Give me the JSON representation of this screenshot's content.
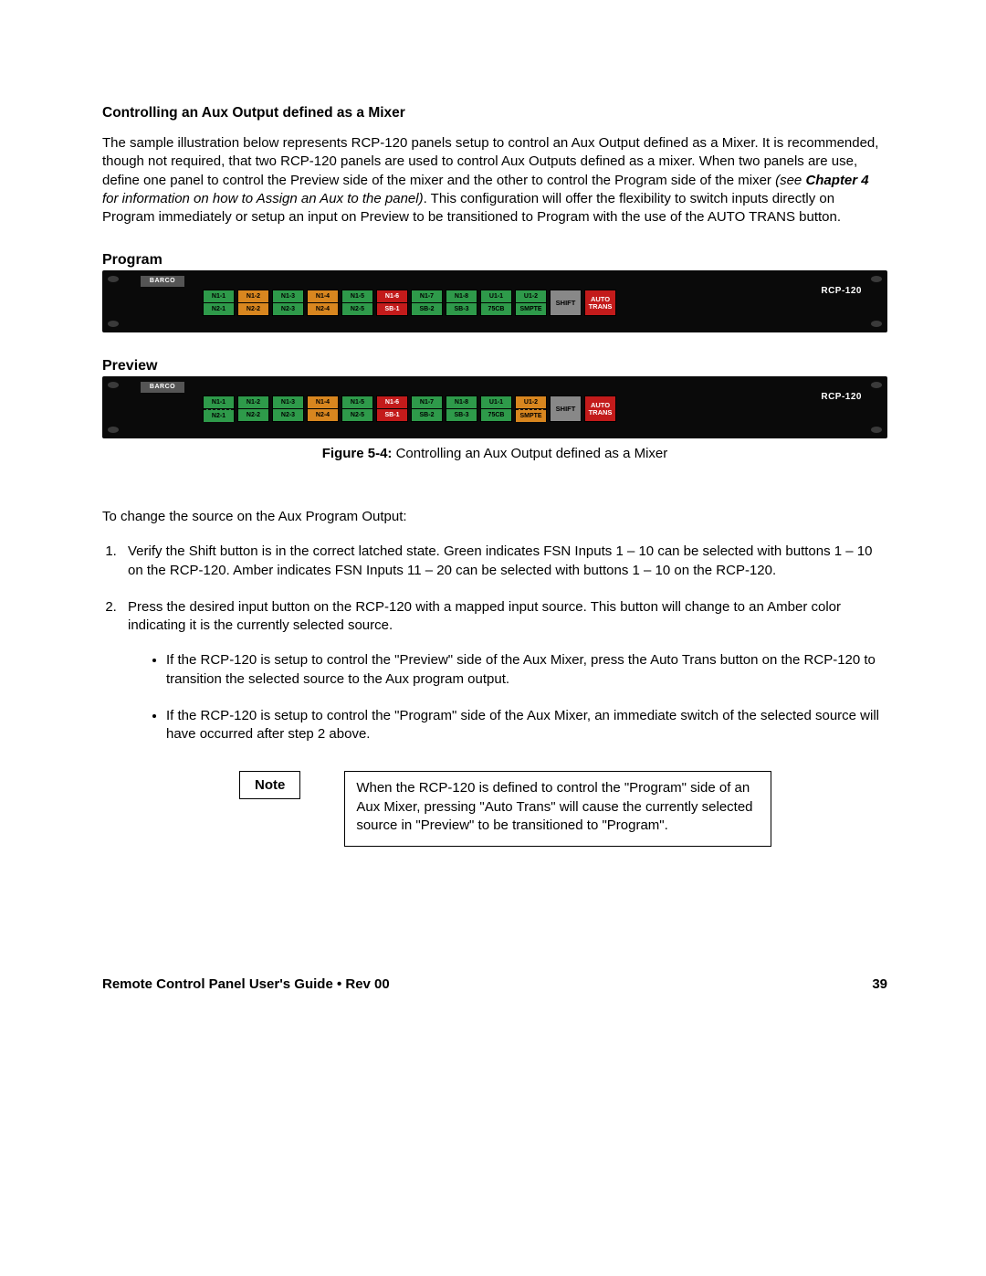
{
  "heading": "Controlling an Aux Output defined as a Mixer",
  "para1_a": "The sample illustration below represents RCP-120 panels setup to control an Aux Output defined as a Mixer. It is recommended, though not required, that two RCP-120 panels are used to control Aux Outputs defined as a mixer. When two panels are use, define one panel to control the Preview side of the mixer and the other to control the Program side of the mixer ",
  "para1_ref_pre": "(see ",
  "para1_ref_bold": "Chapter 4",
  "para1_ref_post": " for information on how to Assign an Aux to the panel)",
  "para1_b": ". This configuration will offer the flexibility to switch inputs directly on Program immediately or setup an input on Preview to be transitioned to Program with the use of the AUTO TRANS button.",
  "program_label": "Program",
  "preview_label": "Preview",
  "barco": "BARCO",
  "model": "RCP-120",
  "program_panel": {
    "buttons": [
      {
        "top": "N1-1",
        "bot": "N2-1",
        "tc": "g",
        "bc": "g"
      },
      {
        "top": "N1-2",
        "bot": "N2-2",
        "tc": "a",
        "bc": "a"
      },
      {
        "top": "N1-3",
        "bot": "N2-3",
        "tc": "g",
        "bc": "g"
      },
      {
        "top": "N1-4",
        "bot": "N2-4",
        "tc": "a",
        "bc": "a"
      },
      {
        "top": "N1-5",
        "bot": "N2-5",
        "tc": "g",
        "bc": "g"
      },
      {
        "top": "N1-6",
        "bot": "SB-1",
        "tc": "r",
        "bc": "r"
      },
      {
        "top": "N1-7",
        "bot": "SB-2",
        "tc": "g",
        "bc": "g"
      },
      {
        "top": "N1-8",
        "bot": "SB-3",
        "tc": "g",
        "bc": "g"
      },
      {
        "top": "U1-1",
        "bot": "75CB",
        "tc": "g",
        "bc": "g"
      },
      {
        "top": "U1-2",
        "bot": "SMPTE",
        "tc": "g",
        "bc": "g"
      }
    ],
    "shift": {
      "label": "SHIFT",
      "c": "gr"
    },
    "auto": {
      "label": "AUTO\nTRANS",
      "c": "r"
    }
  },
  "preview_panel": {
    "buttons": [
      {
        "top": "N1-1",
        "bot": "N2-1",
        "tc": "g",
        "bc": "g",
        "dashed": true
      },
      {
        "top": "N1-2",
        "bot": "N2-2",
        "tc": "g",
        "bc": "g"
      },
      {
        "top": "N1-3",
        "bot": "N2-3",
        "tc": "g",
        "bc": "g"
      },
      {
        "top": "N1-4",
        "bot": "N2-4",
        "tc": "a",
        "bc": "a"
      },
      {
        "top": "N1-5",
        "bot": "N2-5",
        "tc": "g",
        "bc": "g"
      },
      {
        "top": "N1-6",
        "bot": "SB-1",
        "tc": "r",
        "bc": "r"
      },
      {
        "top": "N1-7",
        "bot": "SB-2",
        "tc": "g",
        "bc": "g"
      },
      {
        "top": "N1-8",
        "bot": "SB-3",
        "tc": "g",
        "bc": "g"
      },
      {
        "top": "U1-1",
        "bot": "75CB",
        "tc": "g",
        "bc": "g"
      },
      {
        "top": "U1-2",
        "bot": "SMPTE",
        "tc": "a",
        "bc": "a",
        "dashed": true
      }
    ],
    "shift": {
      "label": "SHIFT",
      "c": "gr"
    },
    "auto": {
      "label": "AUTO\nTRANS",
      "c": "r"
    }
  },
  "figure_caption_bold": "Figure 5-4:",
  "figure_caption_text": " Controlling an Aux Output defined as a Mixer",
  "instr_lead": "To change the source on the Aux Program Output:",
  "steps": [
    "Verify the Shift button is in the correct latched state. Green indicates FSN Inputs 1 – 10 can be selected with buttons 1 – 10 on the RCP-120. Amber indicates FSN Inputs 11 – 20 can be selected with buttons 1 – 10 on the RCP-120.",
    "Press the desired input button on the RCP-120 with a mapped input source. This button will change to an Amber color indicating it is the currently selected source."
  ],
  "bullets": [
    "If the RCP-120 is setup to control the \"Preview\" side of the Aux Mixer, press the Auto Trans button on the RCP-120 to transition the selected source to the Aux program output.",
    "If the RCP-120 is setup to control the \"Program\" side of the Aux Mixer, an immediate switch of the selected source will have occurred after step 2 above."
  ],
  "note_label": "Note",
  "note_text": "When the RCP-120 is defined to control the \"Program\" side of an Aux Mixer, pressing \"Auto Trans\" will cause the currently selected source in \"Preview\" to be transitioned to \"Program\".",
  "footer_left": "Remote Control Panel User's Guide • Rev 00",
  "footer_right": "39"
}
